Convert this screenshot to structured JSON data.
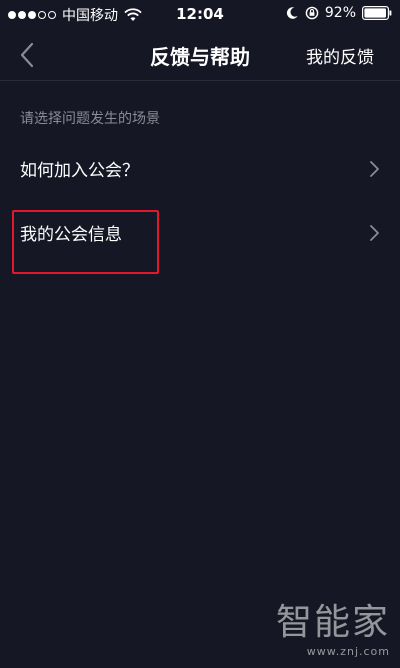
{
  "status_bar": {
    "carrier": "中国移动",
    "time": "12:04",
    "battery_percent": "92%",
    "signal_bars_filled": 3,
    "signal_bars_total": 5
  },
  "nav": {
    "title": "反馈与帮助",
    "right_action": "我的反馈"
  },
  "content": {
    "section_hint": "请选择问题发生的场景",
    "items": [
      {
        "label": "如何加入公会？"
      },
      {
        "label": "我的公会信息"
      }
    ]
  },
  "watermark": {
    "logo": "智能家",
    "url": "www.znj.com"
  },
  "colors": {
    "background": "#161724",
    "highlight": "#e3182c",
    "hint_text": "#8a8b96"
  }
}
